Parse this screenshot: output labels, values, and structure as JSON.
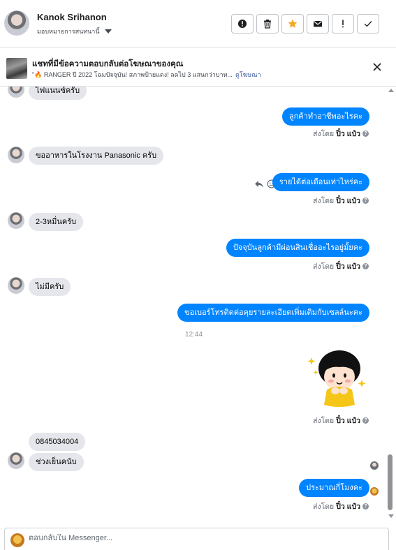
{
  "header": {
    "name": "Kanok Srihanon",
    "assign_label": "มอบหมายการสนทนานี้",
    "actions": [
      {
        "icon": "alert-circle-icon",
        "label": "!"
      },
      {
        "icon": "trash-icon",
        "label": ""
      },
      {
        "icon": "star-icon",
        "label": ""
      },
      {
        "icon": "envelope-icon",
        "label": ""
      },
      {
        "icon": "exclamation-icon",
        "label": "!"
      },
      {
        "icon": "check-icon",
        "label": ""
      }
    ]
  },
  "ad": {
    "title": "แชทที่มีข้อความตอบกลับต่อโฆษณาของคุณ",
    "subtitle": "\"🔥 RANGER ปี 2022 โฉมปัจจุบัน! สภาพป้ายแดง! ลดไป 3 แสนกว่าบาท...",
    "link": "ดูโฆษณา"
  },
  "messages": {
    "m0": "ไฟแนนซ์ครับ",
    "m1": "ลูกค้าทำอาชีพอะไรคะ",
    "m2": "ขออาหารในโรงงาน Panasonic ครับ",
    "m3": "รายได้ต่อเดือนเท่าไหร่คะ",
    "m4": "2-3หมื่นครับ",
    "m5": "ปัจจุบันลูกค้ามีผ่อนสินเชื่ออะไรอยู่มั้ยคะ",
    "m6": "ไม่มีครับ",
    "m7": "ขอเบอร์โทรติดต่อคุยรายละเอียดเพิ่มเติมกับเซลล์นะคะ",
    "time": "12:44",
    "m8": "0845034004",
    "m9": "ช่วงเย็นคนับ",
    "m10": "ประมาณกี่โมงคะ"
  },
  "sent_by": {
    "prefix": "ส่งโดย",
    "name": "ปิ๋ว แป๋ว"
  },
  "composer": {
    "placeholder": "ตอบกลับใน Messenger..."
  },
  "colors": {
    "outgoing": "#0084ff",
    "incoming": "#e4e6eb",
    "star": "#f5a623"
  }
}
